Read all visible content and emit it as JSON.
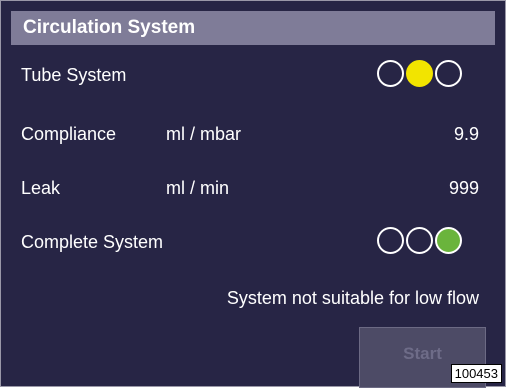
{
  "header": {
    "title": "Circulation System"
  },
  "rows": [
    {
      "label": "Tube System",
      "lights": [
        "off",
        "yellow",
        "off"
      ]
    },
    {
      "label": "Compliance",
      "unit": "ml / mbar",
      "value": "9.9"
    },
    {
      "label": "Leak",
      "unit": "ml / min",
      "value": "999"
    },
    {
      "label": "Complete System",
      "lights": [
        "off",
        "off",
        "green"
      ]
    }
  ],
  "status_text": "System not suitable for low flow",
  "start_button": {
    "label": "Start",
    "enabled": false
  },
  "figure_id": "100453",
  "colors": {
    "panel_bg": "#272545",
    "header_bg": "#7f7c98",
    "light_yellow": "#f2e400",
    "light_green": "#6ab43c",
    "button_disabled_bg": "#4d4b66",
    "button_disabled_text": "#6e6c88"
  }
}
